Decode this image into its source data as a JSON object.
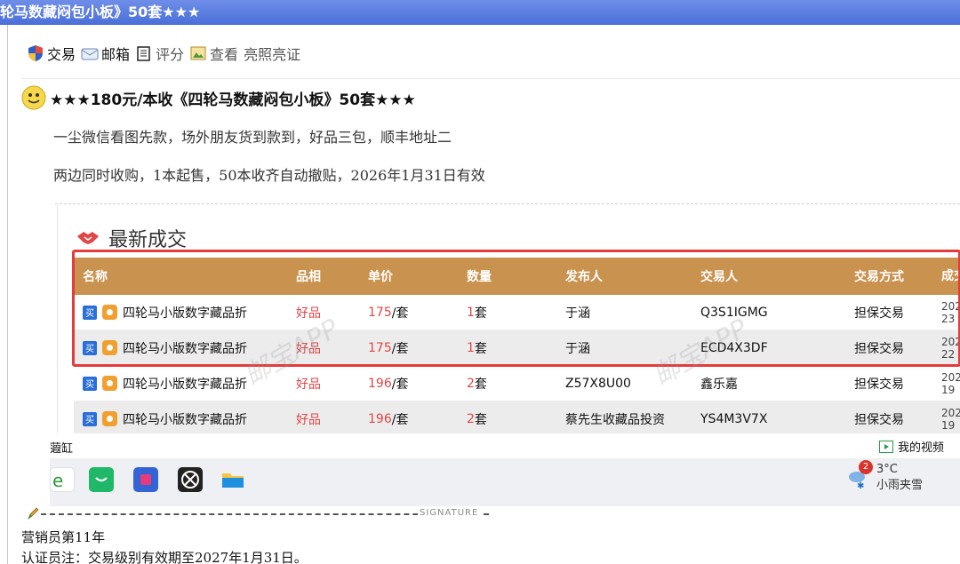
{
  "window": {
    "title": "轮马数藏闷包小板》50套★★★"
  },
  "toolbar": {
    "trade": "交易",
    "mail": "邮箱",
    "rate": "评分",
    "view": "查看",
    "license": "亮照亮证"
  },
  "post": {
    "title": "★★★180元/本收《四轮马数藏闷包小板》50套★★★",
    "line1": "一尘微信看图先款，场外朋友货到款到，好品三包，顺丰地址二",
    "line2": "两边同时收购，1本起售，50本收齐自动撤贴，2026年1月31日有效"
  },
  "embed": {
    "section_title": "最新成交",
    "watermark": "邮宝APP",
    "columns": [
      "名称",
      "品相",
      "单价",
      "数量",
      "发布人",
      "交易人",
      "交易方式",
      "成交"
    ],
    "rows": [
      {
        "badge": "买",
        "name": "四轮马小版数字藏品折",
        "condition": "好品",
        "price": "175",
        "unit": "/套",
        "qty": "1",
        "qty_unit": "套",
        "publisher": "于涵",
        "trader": "Q3S1IGMG",
        "method": "担保交易",
        "date1": "202",
        "date2": "23"
      },
      {
        "badge": "买",
        "name": "四轮马小版数字藏品折",
        "condition": "好品",
        "price": "175",
        "unit": "/套",
        "qty": "1",
        "qty_unit": "套",
        "publisher": "于涵",
        "trader": "ECD4X3DF",
        "method": "担保交易",
        "date1": "202",
        "date2": "22"
      },
      {
        "badge": "买",
        "name": "四轮马小版数字藏品折",
        "condition": "好品",
        "price": "196",
        "unit": "/套",
        "qty": "2",
        "qty_unit": "套",
        "publisher": "Z57X8U00",
        "trader": "鑫乐嘉",
        "method": "担保交易",
        "date1": "202",
        "date2": "19"
      },
      {
        "badge": "买",
        "name": "四轮马小版数字藏品折",
        "condition": "好品",
        "price": "196",
        "unit": "/套",
        "qty": "2",
        "qty_unit": "套",
        "publisher": "蔡先生收藏品投资",
        "trader": "YS4M3V7X",
        "method": "担保交易",
        "date1": "202",
        "date2": "19"
      }
    ],
    "strip_left": "蕸缸",
    "my_videos": "我的视频",
    "weather": {
      "badge": "2",
      "temp": "3°C",
      "desc": "小雨夹雪"
    }
  },
  "signature": {
    "label": "SIGNATURE",
    "line1": "营销员第11年",
    "line2": "认证员注：交易级别有效期至2027年1月31日。"
  },
  "colors": {
    "header": "#c9924f",
    "highlight": "#e53b3b",
    "accent_red": "#e04646",
    "titlebar": "#5b7de0"
  }
}
